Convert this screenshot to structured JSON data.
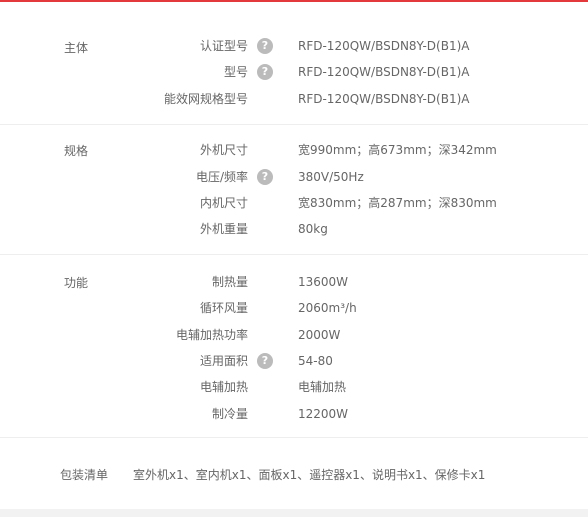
{
  "sections": [
    {
      "title": "主体",
      "rows": [
        {
          "label": "认证型号",
          "help": true,
          "value": "RFD-120QW/BSDN8Y-D(B1)A"
        },
        {
          "label": "型号",
          "help": true,
          "value": "RFD-120QW/BSDN8Y-D(B1)A"
        },
        {
          "label": "能效网规格型号",
          "help": false,
          "value": "RFD-120QW/BSDN8Y-D(B1)A"
        }
      ]
    },
    {
      "title": "规格",
      "rows": [
        {
          "label": "外机尺寸",
          "help": false,
          "value": "宽990mm；高673mm；深342mm"
        },
        {
          "label": "电压/频率",
          "help": true,
          "value": "380V/50Hz"
        },
        {
          "label": "内机尺寸",
          "help": false,
          "value": "宽830mm；高287mm；深830mm"
        },
        {
          "label": "外机重量",
          "help": false,
          "value": "80kg"
        }
      ]
    },
    {
      "title": "功能",
      "rows": [
        {
          "label": "制热量",
          "help": false,
          "value": "13600W"
        },
        {
          "label": "循环风量",
          "help": false,
          "value": "2060m³/h"
        },
        {
          "label": "电辅加热功率",
          "help": false,
          "value": "2000W"
        },
        {
          "label": "适用面积",
          "help": true,
          "value": "54-80"
        },
        {
          "label": "电辅加热",
          "help": false,
          "value": "电辅加热"
        },
        {
          "label": "制冷量",
          "help": false,
          "value": "12200W"
        }
      ]
    }
  ],
  "package": {
    "title": "包装清单",
    "value": "室外机x1、室内机x1、面板x1、遥控器x1、说明书x1、保修卡x1"
  },
  "help_icon_glyph": "?",
  "colors": {
    "accent": "#e4393c",
    "text": "#666666",
    "help_icon": "#bbbbbb"
  }
}
